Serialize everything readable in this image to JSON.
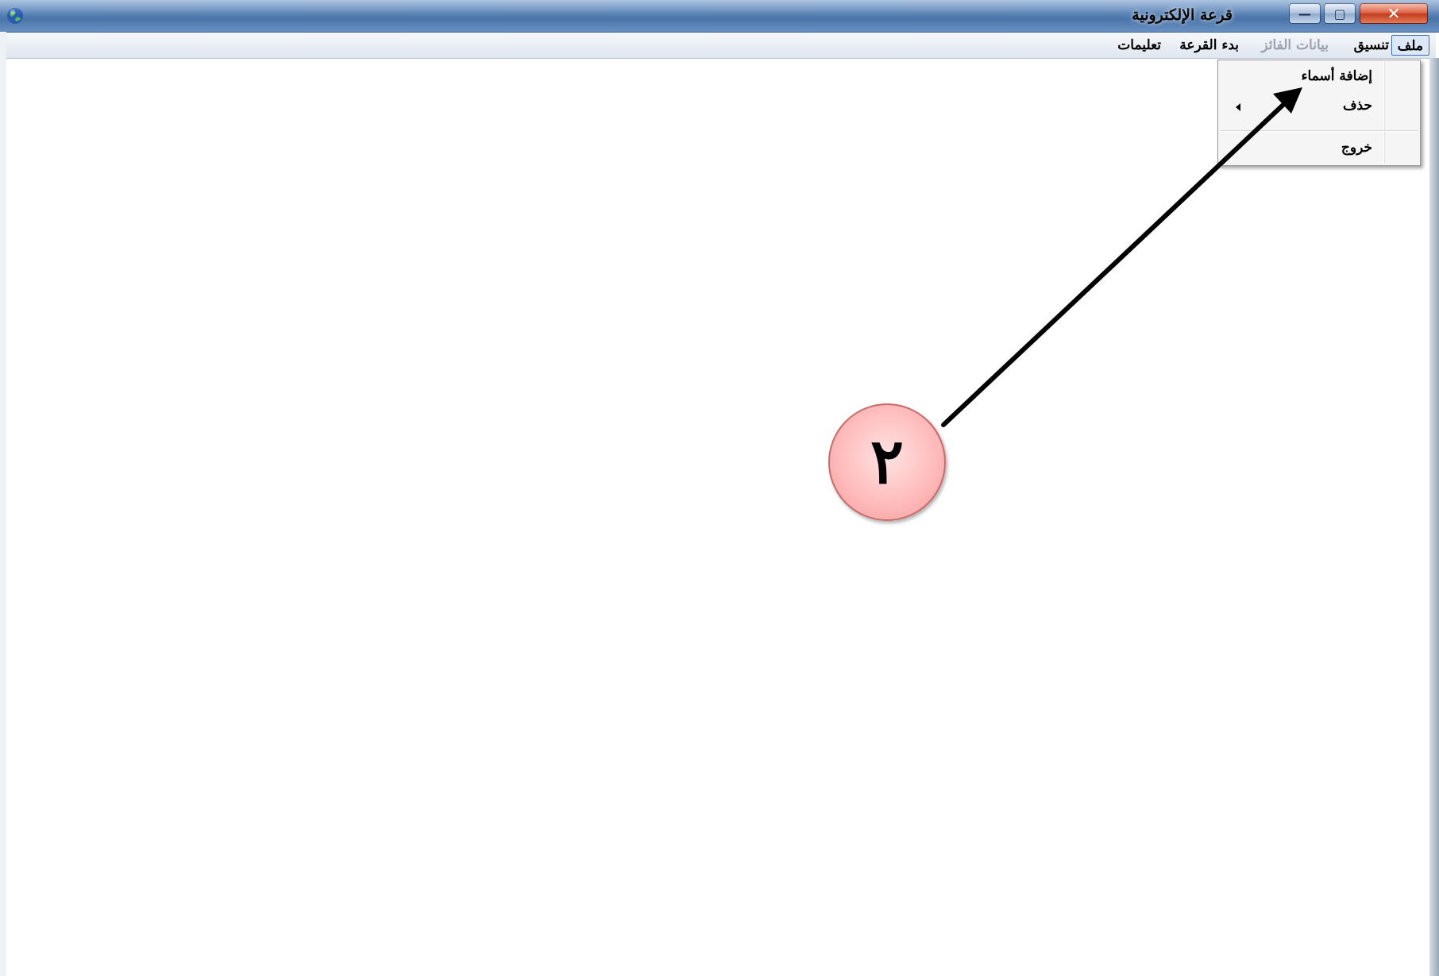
{
  "window": {
    "title": "قرعة الإلكترونية",
    "min_symbol": "—",
    "max_symbol": "▢",
    "close_symbol": "✕"
  },
  "menubar": {
    "items": [
      {
        "label": "ملف",
        "active": true
      },
      {
        "label": "تنسيق"
      },
      {
        "label": "بيانات الفائز",
        "disabled": true
      },
      {
        "label": "بدء القرعة"
      },
      {
        "label": "تعليمات"
      }
    ]
  },
  "file_menu": {
    "items": [
      {
        "label": "إضافة أسماء"
      },
      {
        "label": "حذف",
        "has_submenu": true
      },
      {
        "label": "خروج"
      }
    ]
  },
  "annotation": {
    "badge_label": "٢",
    "badge_color": "#ffbcbc",
    "arrow_color": "#000000"
  }
}
